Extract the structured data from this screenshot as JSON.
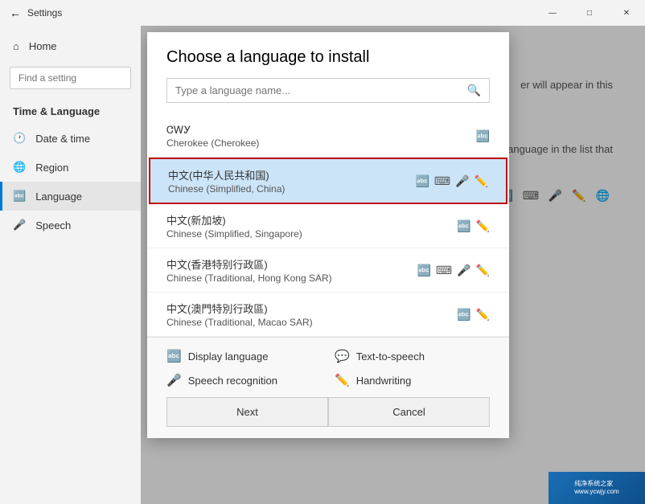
{
  "window": {
    "title": "Settings",
    "controls": {
      "minimize": "—",
      "maximize": "□",
      "close": "✕"
    }
  },
  "sidebar": {
    "back_label": "Settings",
    "home_label": "Home",
    "search_placeholder": "Find a setting",
    "section_title": "Time & Language",
    "items": [
      {
        "id": "date-time",
        "label": "Date & time",
        "icon": "🕐"
      },
      {
        "id": "region",
        "label": "Region",
        "icon": "🌐"
      },
      {
        "id": "language",
        "label": "Language",
        "icon": "🔤"
      },
      {
        "id": "speech",
        "label": "Speech",
        "icon": "🎤"
      }
    ]
  },
  "dialog": {
    "title": "Choose a language to install",
    "search_placeholder": "Type a language name...",
    "languages": [
      {
        "id": "cwy",
        "name": "ᏣᎳᎩ",
        "subname": "Cherokee (Cherokee)",
        "icons": [
          "text"
        ],
        "selected": false
      },
      {
        "id": "zh-cn",
        "name": "中文(中华人民共和国)",
        "subname": "Chinese (Simplified, China)",
        "icons": [
          "text",
          "keyboard",
          "mic",
          "edit"
        ],
        "selected": true
      },
      {
        "id": "zh-sg",
        "name": "中文(新加坡)",
        "subname": "Chinese (Simplified, Singapore)",
        "icons": [
          "text",
          "edit"
        ],
        "selected": false
      },
      {
        "id": "zh-hk",
        "name": "中文(香港特别行政區)",
        "subname": "Chinese (Traditional, Hong Kong SAR)",
        "icons": [
          "text",
          "keyboard",
          "mic",
          "edit"
        ],
        "selected": false
      },
      {
        "id": "zh-mo",
        "name": "中文(澳門特別行政區)",
        "subname": "Chinese (Traditional, Macao SAR)",
        "icons": [
          "text",
          "edit"
        ],
        "selected": false
      }
    ],
    "features": [
      {
        "id": "display",
        "icon": "🔤",
        "label": "Display language"
      },
      {
        "id": "tts",
        "icon": "💬",
        "label": "Text-to-speech"
      },
      {
        "id": "speech",
        "icon": "🎤",
        "label": "Speech recognition"
      },
      {
        "id": "handwriting",
        "icon": "✏️",
        "label": "Handwriting"
      }
    ],
    "buttons": {
      "next": "Next",
      "cancel": "Cancel"
    }
  },
  "content": {
    "text1": "er will appear in this",
    "text2": "anguage in the list that"
  }
}
